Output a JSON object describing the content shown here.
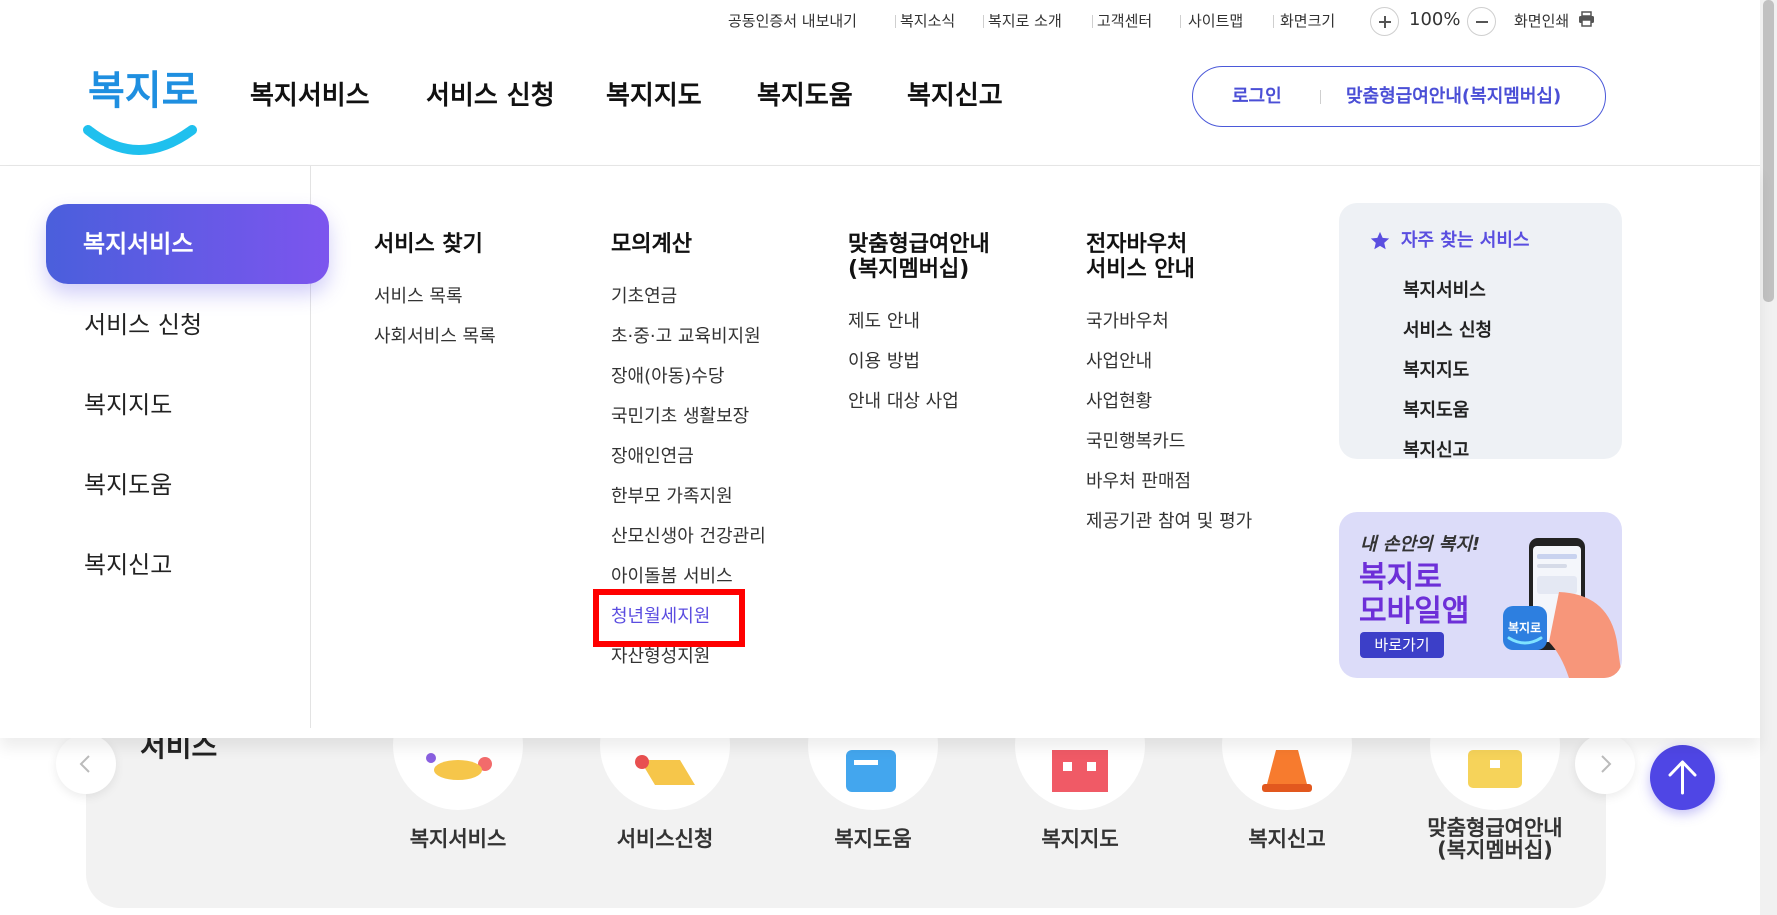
{
  "utility_bar": {
    "cert_export": "공동인증서 내보내기",
    "news": "복지소식",
    "about": "복지로 소개",
    "customer_center": "고객센터",
    "sitemap": "사이트맵",
    "screen_size": "화면크기",
    "zoom_level": "100%",
    "print": "화면인쇄"
  },
  "header": {
    "logo_text": "복지로",
    "nav": [
      "복지서비스",
      "서비스 신청",
      "복지지도",
      "복지도움",
      "복지신고"
    ],
    "login": "로그인",
    "membership": "맞춤형급여안내(복지멤버십)"
  },
  "mega_menu": {
    "sidebar": [
      "복지서비스",
      "서비스 신청",
      "복지지도",
      "복지도움",
      "복지신고"
    ],
    "active_sidebar": "복지서비스",
    "columns": [
      {
        "title": "서비스 찾기",
        "links": [
          "서비스 목록",
          "사회서비스 목록"
        ]
      },
      {
        "title": "모의계산",
        "links": [
          "기초연금",
          "초·중·고 교육비지원",
          "장애(아동)수당",
          "국민기초 생활보장",
          "장애인연금",
          "한부모 가족지원",
          "산모신생아 건강관리",
          "아이돌봄 서비스",
          "청년월세지원",
          "자산형성지원"
        ]
      },
      {
        "title_lines": [
          "맞춤형급여안내",
          "(복지멤버십)"
        ],
        "links": [
          "제도 안내",
          "이용 방법",
          "안내 대상 사업"
        ]
      },
      {
        "title_lines": [
          "전자바우처",
          "서비스 안내"
        ],
        "links": [
          "국가바우처",
          "사업안내",
          "사업현황",
          "국민행복카드",
          "바우처 판매점",
          "제공기관 참여 및 평가"
        ]
      }
    ],
    "highlighted_link": "청년월세지원",
    "favorites": {
      "title": "자주 찾는 서비스",
      "links": [
        "복지서비스",
        "서비스 신청",
        "복지지도",
        "복지도움",
        "복지신고"
      ]
    },
    "app_banner": {
      "line1": "내 손안의 복지!",
      "line2": "복지로",
      "line3": "모바일앱",
      "button": "바로가기",
      "icon_text": "복지로"
    }
  },
  "quick_services": {
    "title": "서비스",
    "items": [
      "복지서비스",
      "서비스신청",
      "복지도움",
      "복지지도",
      "복지신고"
    ],
    "last_item_lines": [
      "맞춤형급여안내",
      "(복지멤버십)"
    ]
  },
  "colors": {
    "brand_blue": "#4b59d9",
    "active_gradient_start": "#4a5fdc",
    "active_gradient_end": "#7c55ee",
    "link_active": "#5b4de0",
    "highlight_red": "#ff0000"
  }
}
